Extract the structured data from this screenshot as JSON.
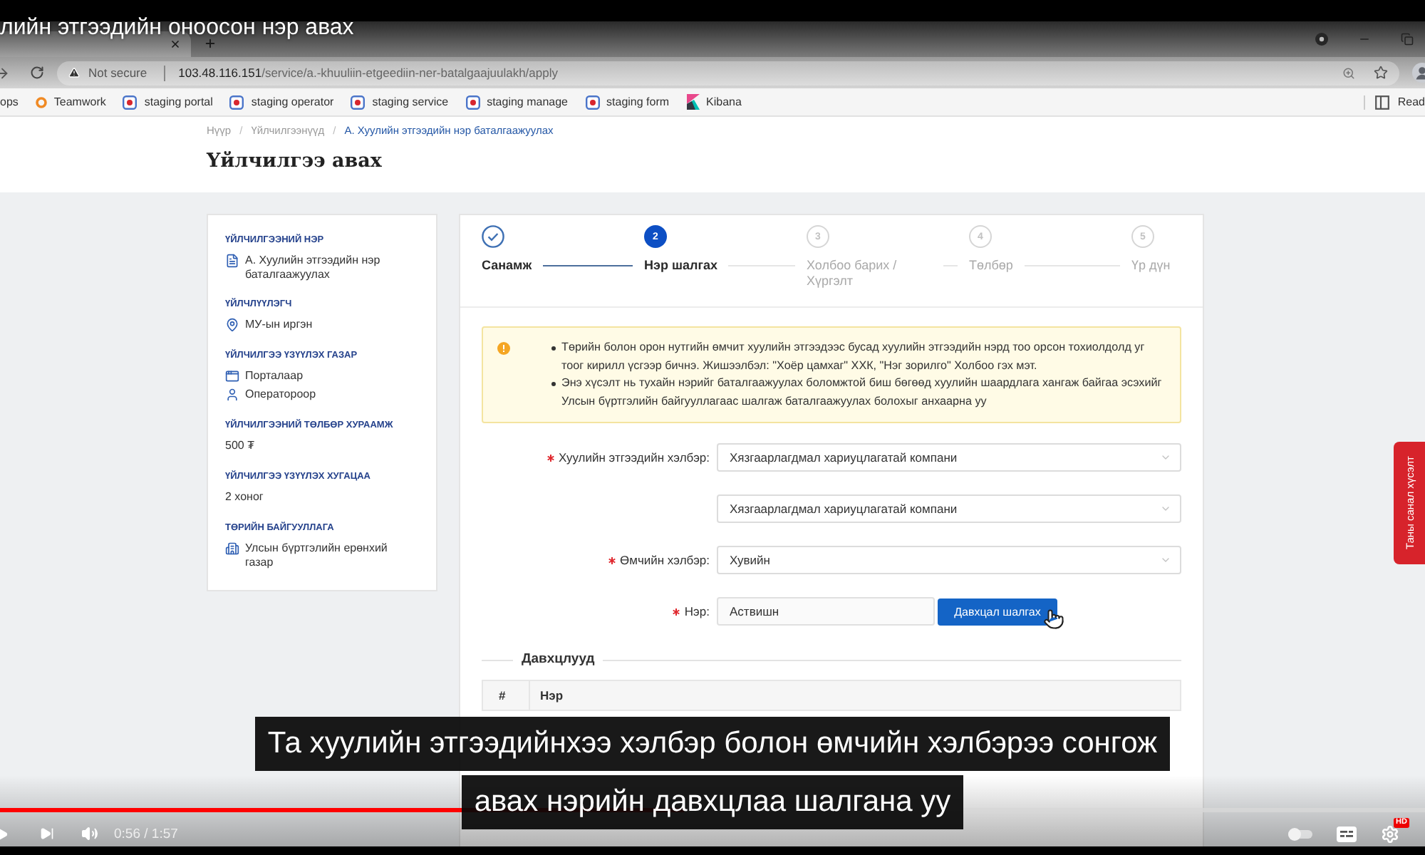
{
  "video": {
    "title": "лийн этгээдийн оноосон нэр авах",
    "captions": [
      "Та хуулийн этгээдийнхээ хэлбэр болон өмчийн хэлбэрээ сонгож",
      "авах нэрийн давхцлаа шалгана уу"
    ],
    "progress": {
      "level": 0.48
    },
    "time": "0:56 / 1:57",
    "quality_badge": "HD",
    "feedback_tab": "Таны санал хүсэлт"
  },
  "browser": {
    "security": "Not secure",
    "url_host": "103.48.116.151",
    "url_path": "/service/a.-khuuliin-etgeediin-ner-batalgaajuulakh/apply",
    "bookmarks": [
      {
        "kind": "apps",
        "label": "ops"
      },
      {
        "kind": "teamwork",
        "label": "Teamwork"
      },
      {
        "kind": "site",
        "label": "staging portal"
      },
      {
        "kind": "site",
        "label": "staging operator"
      },
      {
        "kind": "site",
        "label": "staging service"
      },
      {
        "kind": "site",
        "label": "staging manage"
      },
      {
        "kind": "site",
        "label": "staging form"
      },
      {
        "kind": "kibana",
        "label": "Kibana"
      }
    ],
    "reading_list": "Read"
  },
  "page": {
    "breadcrumb": [
      {
        "label": "Нүүр",
        "current": false
      },
      {
        "label": "Үйлчилгээнүүд",
        "current": false
      },
      {
        "label": "А. Хуулийн этгээдийн нэр баталгаажуулах",
        "current": true
      }
    ],
    "breadcrumb_separator": "/",
    "title": "Үйлчилгээ авах",
    "service_info": [
      {
        "label": "ҮЙЛЧИЛГЭЭНИЙ НЭР",
        "values": [
          "А. Хуулийн этгээдийн нэр баталгаажуулах"
        ]
      },
      {
        "label": "ҮЙЛЧЛҮҮЛЭГЧ",
        "values": [
          "МУ-ын иргэн"
        ]
      },
      {
        "label": "ҮЙЛЧИЛГЭЭ ҮЗҮҮЛЭХ ГАЗАР",
        "values": [
          "Порталаар",
          "Оператороор"
        ]
      },
      {
        "label": "ҮЙЛЧИЛГЭЭНИЙ ТӨЛБӨР ХУРААМЖ",
        "values": [
          "500 ₮"
        ]
      },
      {
        "label": "ҮЙЛЧИЛГЭЭ ҮЗҮҮЛЭХ ХУГАЦАА",
        "values": [
          "2 хоног"
        ]
      },
      {
        "label": "ТӨРИЙН БАЙГУУЛЛАГА",
        "values": [
          "Улсын бүртгэлийн ерөнхий газар"
        ]
      }
    ],
    "stepper": [
      {
        "label": "Санамж",
        "done": true,
        "selected": false
      },
      {
        "number": "2",
        "label": "Нэр шалгах",
        "done": false,
        "selected": true
      },
      {
        "number": "3",
        "label": "Холбоо барих / Хүргэлт",
        "done": false,
        "selected": false
      },
      {
        "number": "4",
        "label": "Төлбөр",
        "done": false,
        "selected": false
      },
      {
        "number": "5",
        "label": "Үр дүн",
        "done": false,
        "selected": false
      }
    ],
    "notice": [
      "Төрийн болон орон нутгийн өмчит хуулийн этгээдээс бусад хуулийн этгээдийн нэрд тоо орсон тохиолдолд уг тоог кирилл үсгээр бичнэ. Жишээлбэл: \"Хоёр цамхаг\" ХХК, \"Нэг зорилго\" Холбоо гэх мэт.",
      "Энэ хүсэлт нь тухайн нэрийг баталгаажуулах боломжтой биш бөгөөд хуулийн шаардлага хангаж байгаа эсэхийг Улсын бүртгэлийн байгууллагаас шалгаж баталгаажуулах болохыг анхаарна уу"
    ],
    "form": [
      {
        "kind": "select",
        "label": "Хуулийн этгээдийн хэлбэр:",
        "required": true,
        "value": "Хязгаарлагдмал хариуцлагатай компани"
      },
      {
        "kind": "select",
        "value": "Хязгаарлагдмал хариуцлагатай компани"
      },
      {
        "kind": "select",
        "label": "Өмчийн хэлбэр:",
        "required": true,
        "value": "Хувийн"
      },
      {
        "kind": "input",
        "label": "Нэр:",
        "required": true,
        "value": "Аствишн",
        "button": "Давхцал шалгах"
      }
    ],
    "duplicates": {
      "title": "Давхцлууд",
      "columns": [
        "#",
        "Нэр"
      ]
    }
  }
}
